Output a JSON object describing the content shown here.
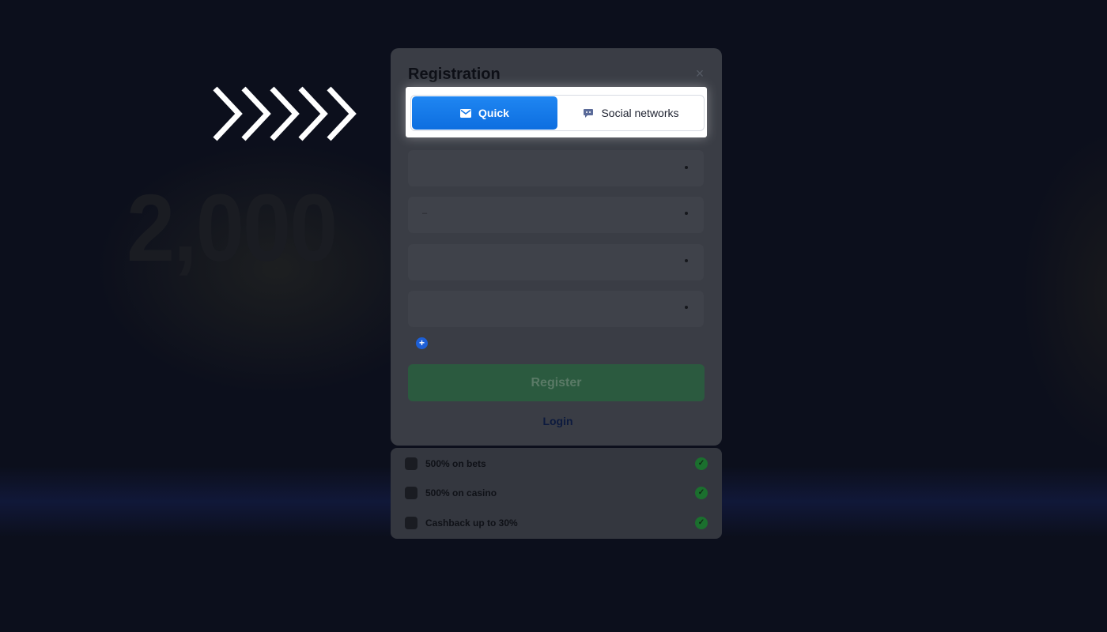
{
  "background": {
    "promo_amount": "2,000",
    "right_line_1": "",
    "right_line_2": ""
  },
  "modal": {
    "title": "Registration",
    "close_icon": "close-icon",
    "tabs": [
      {
        "label": "Quick",
        "icon": "envelope-icon",
        "active": true
      },
      {
        "label": "Social networks",
        "icon": "chat-bubble-icon",
        "active": false
      }
    ],
    "fields": [
      {
        "name": "country",
        "placeholder": ""
      },
      {
        "name": "currency",
        "placeholder": "–"
      },
      {
        "name": "phone",
        "placeholder": ""
      },
      {
        "name": "bonus",
        "placeholder": ""
      }
    ],
    "promo_code_label": "",
    "register_label": "Register",
    "login_prompt": "",
    "login_link": "Login"
  },
  "bonuses": [
    {
      "label": "500% on bets",
      "icon": "sports-icon"
    },
    {
      "label": "500% on casino",
      "icon": "casino-icon"
    },
    {
      "label": "Cashback up to 30%",
      "icon": "cashback-icon"
    }
  ],
  "disclaimer": "",
  "colors": {
    "accent_blue": "#1f86f2",
    "register_green": "#2b5a3f",
    "overlay": "#0c0f1c"
  }
}
